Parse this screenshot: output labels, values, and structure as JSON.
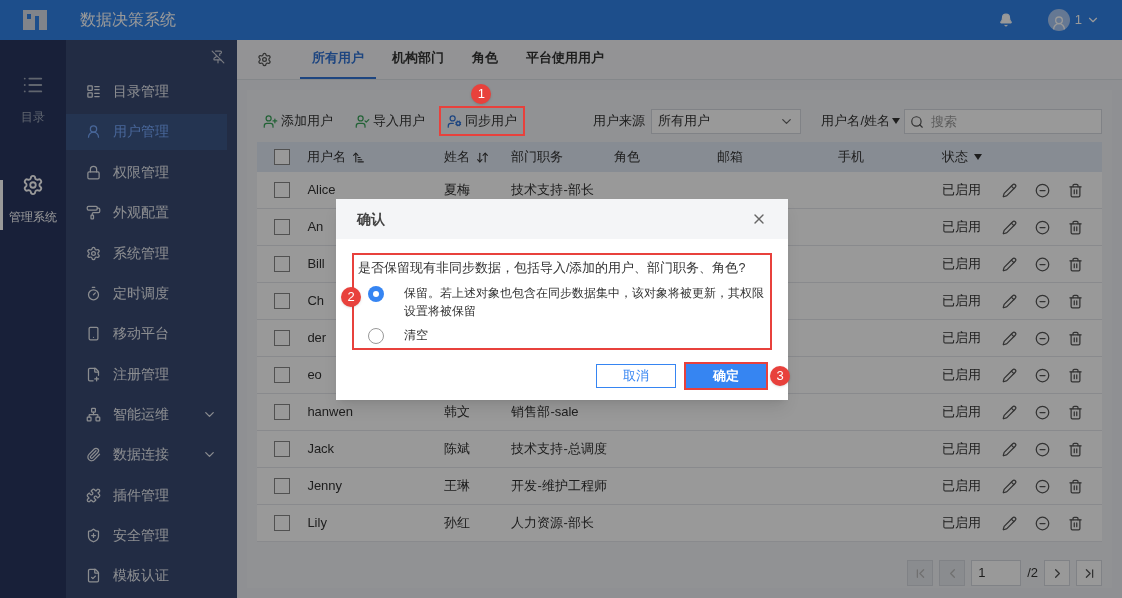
{
  "topbar": {
    "title": "数据决策系统",
    "user": "1"
  },
  "rail": [
    {
      "label": "目录",
      "selected": false
    },
    {
      "label": "管理系统",
      "selected": true
    }
  ],
  "menu": [
    {
      "label": "目录管理",
      "selected": false,
      "expandable": false
    },
    {
      "label": "用户管理",
      "selected": true,
      "expandable": false
    },
    {
      "label": "权限管理",
      "selected": false,
      "expandable": false
    },
    {
      "label": "外观配置",
      "selected": false,
      "expandable": false
    },
    {
      "label": "系统管理",
      "selected": false,
      "expandable": false
    },
    {
      "label": "定时调度",
      "selected": false,
      "expandable": false
    },
    {
      "label": "移动平台",
      "selected": false,
      "expandable": false
    },
    {
      "label": "注册管理",
      "selected": false,
      "expandable": false
    },
    {
      "label": "智能运维",
      "selected": false,
      "expandable": true
    },
    {
      "label": "数据连接",
      "selected": false,
      "expandable": true
    },
    {
      "label": "插件管理",
      "selected": false,
      "expandable": false
    },
    {
      "label": "安全管理",
      "selected": false,
      "expandable": false
    },
    {
      "label": "模板认证",
      "selected": false,
      "expandable": false
    }
  ],
  "tabs": [
    {
      "label": "所有用户",
      "selected": true
    },
    {
      "label": "机构部门",
      "selected": false
    },
    {
      "label": "角色",
      "selected": false
    },
    {
      "label": "平台使用用户",
      "selected": false
    }
  ],
  "toolbar": [
    {
      "label": "添加用户",
      "kind": "add",
      "highlighted": false
    },
    {
      "label": "导入用户",
      "kind": "import",
      "highlighted": false
    },
    {
      "label": "同步用户",
      "kind": "sync",
      "highlighted": true,
      "badge": "1"
    }
  ],
  "source_filter": {
    "label": "用户来源",
    "value": "所有用户"
  },
  "search": {
    "field": "用户名/姓名",
    "placeholder": "搜索"
  },
  "table": {
    "all_checked": false,
    "columns": [
      {
        "label": "用户名",
        "kind": "sort-list"
      },
      {
        "label": "姓名",
        "kind": "sort"
      },
      {
        "label": "部门职务",
        "kind": "plain"
      },
      {
        "label": "角色",
        "kind": "plain"
      },
      {
        "label": "邮箱",
        "kind": "plain"
      },
      {
        "label": "手机",
        "kind": "plain"
      },
      {
        "label": "状态",
        "kind": "filter"
      }
    ],
    "rows": [
      {
        "checked": false,
        "username": "Alice",
        "name": "夏梅",
        "dept": "技术支持-部长",
        "status": "已启用"
      },
      {
        "checked": false,
        "username": "An",
        "status": "已启用"
      },
      {
        "checked": false,
        "username": "Bill",
        "status": "已启用"
      },
      {
        "checked": false,
        "username": "Ch",
        "status": "已启用"
      },
      {
        "checked": false,
        "username": "der",
        "status": "已启用"
      },
      {
        "checked": false,
        "username": "eo",
        "status": "已启用"
      },
      {
        "checked": false,
        "username": "hanwen",
        "name": "韩文",
        "dept": "销售部-sale",
        "status": "已启用"
      },
      {
        "checked": false,
        "username": "Jack",
        "name": "陈斌",
        "dept": "技术支持-总调度",
        "status": "已启用"
      },
      {
        "checked": false,
        "username": "Jenny",
        "name": "王琳",
        "dept": "开发-维护工程师",
        "status": "已启用"
      },
      {
        "checked": false,
        "username": "Lily",
        "name": "孙红",
        "dept": "人力资源-部长",
        "status": "已启用"
      }
    ]
  },
  "pagination": {
    "page": "1",
    "total": "/2"
  },
  "dialog": {
    "title": "确认",
    "question": "是否保留现有非同步数据，包括导入/添加的用户、部门职务、角色?",
    "options_badge": "2",
    "options": [
      {
        "label": "保留。若上述对象也包含在同步数据集中，该对象将被更新，其权限设置将被保留",
        "selected": true
      },
      {
        "label": "清空",
        "selected": false
      }
    ],
    "cancel": "取消",
    "confirm": "确定",
    "confirm_badge": "3"
  }
}
